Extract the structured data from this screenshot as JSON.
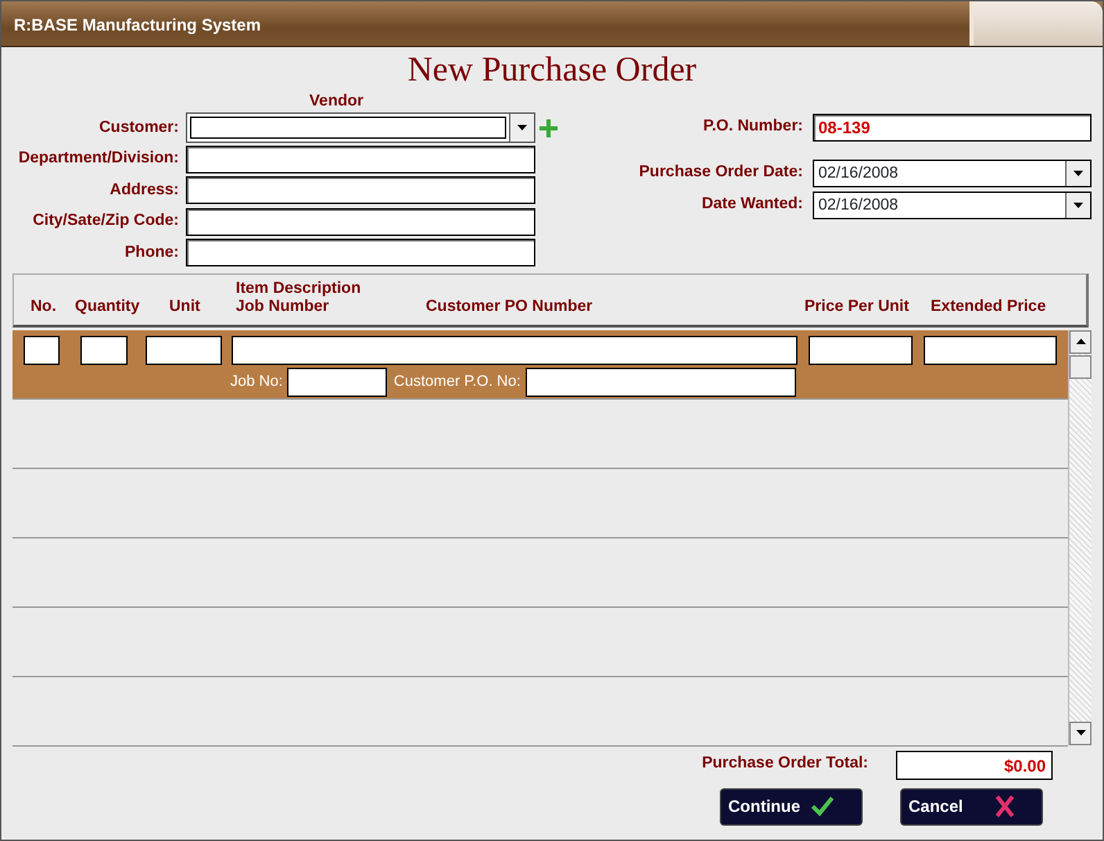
{
  "window": {
    "title": "R:BASE Manufacturing System"
  },
  "heading": "New Purchase Order",
  "vendor_caption": "Vendor",
  "left_fields": [
    {
      "label": "Customer:",
      "kind": "combo"
    },
    {
      "label": "Department/Division:",
      "kind": "text"
    },
    {
      "label": "Address:",
      "kind": "text"
    },
    {
      "label": "City/Sate/Zip Code:",
      "kind": "text"
    },
    {
      "label": "Phone:",
      "kind": "text"
    }
  ],
  "right_fields": [
    {
      "label": "P.O. Number:",
      "kind": "text",
      "value": "08-139"
    },
    {
      "label": "Purchase Order Date:",
      "kind": "date",
      "value": "02/16/2008"
    },
    {
      "label": "Date Wanted:",
      "kind": "date",
      "value": "02/16/2008"
    }
  ],
  "table": {
    "columns": [
      {
        "label": "No."
      },
      {
        "label": "Quantity"
      },
      {
        "label": "Unit"
      },
      {
        "label": "Job Number",
        "top_line": "Item Description"
      },
      {
        "label": "Customer PO Number"
      },
      {
        "label": "Price Per Unit"
      },
      {
        "label": "Extended Price"
      }
    ],
    "rows": [
      {
        "selected": true,
        "job_label": "Job No:",
        "customer_po_label": "Customer P.O. No:"
      },
      {
        "selected": false
      },
      {
        "selected": false
      },
      {
        "selected": false
      },
      {
        "selected": false
      },
      {
        "selected": false
      }
    ]
  },
  "total": {
    "label": "Purchase Order Total:",
    "value": "$0.00"
  },
  "buttons": [
    {
      "label": "Continue",
      "kind": "confirm"
    },
    {
      "label": "Cancel",
      "kind": "cancel"
    }
  ]
}
